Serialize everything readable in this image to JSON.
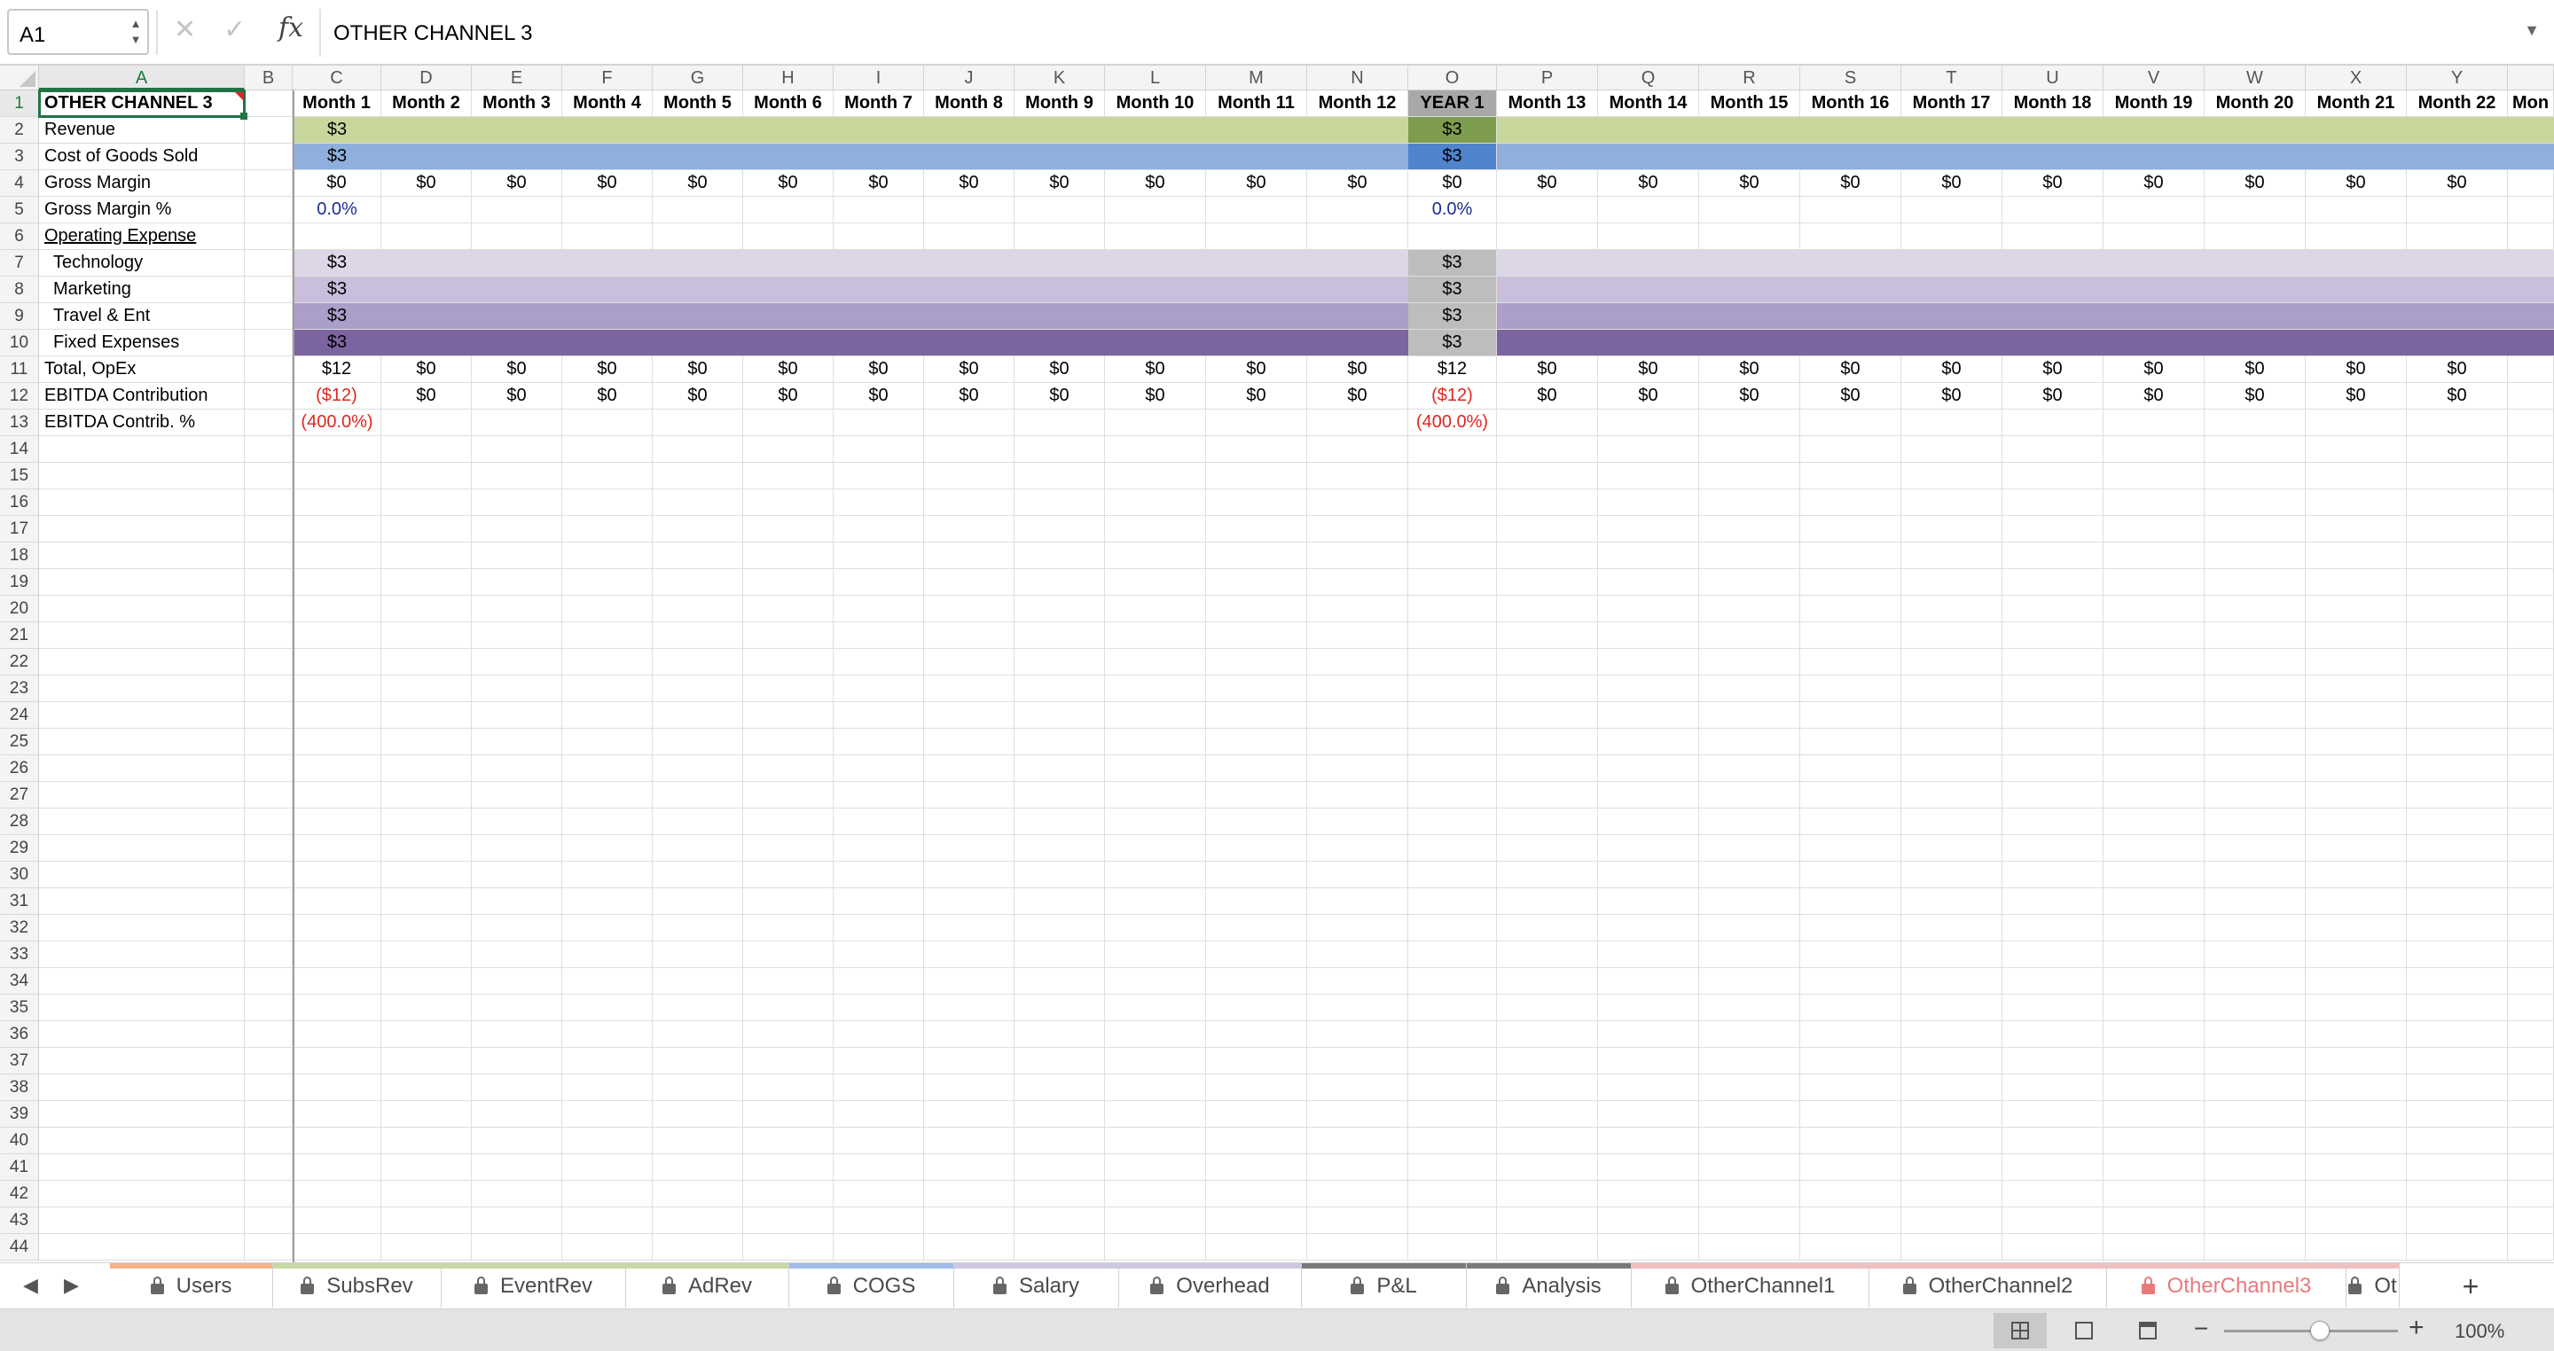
{
  "formula_bar": {
    "name_box": "A1",
    "formula": "OTHER CHANNEL 3",
    "fx_label": "fx"
  },
  "columns": [
    "A",
    "B",
    "C",
    "D",
    "E",
    "F",
    "G",
    "H",
    "I",
    "J",
    "K",
    "L",
    "M",
    "N",
    "O",
    "P",
    "Q",
    "R",
    "S",
    "T",
    "U",
    "V",
    "W",
    "X",
    "Y"
  ],
  "header_row": [
    "OTHER CHANNEL 3",
    "",
    "Month 1",
    "Month 2",
    "Month 3",
    "Month 4",
    "Month 5",
    "Month 6",
    "Month 7",
    "Month 8",
    "Month 9",
    "Month 10",
    "Month 11",
    "Month 12",
    "YEAR 1",
    "Month 13",
    "Month 14",
    "Month 15",
    "Month 16",
    "Month 17",
    "Month 18",
    "Month 19",
    "Month 20",
    "Month 21",
    "Month 22",
    "Mon"
  ],
  "rows": [
    {
      "label": "Revenue",
      "c": "$3",
      "o": "$3",
      "fill": "revenue"
    },
    {
      "label": "Cost of Goods Sold",
      "c": "$3",
      "o": "$3",
      "fill": "cogs"
    },
    {
      "label": "Gross Margin",
      "values": [
        "$0",
        "$0",
        "$0",
        "$0",
        "$0",
        "$0",
        "$0",
        "$0",
        "$0",
        "$0",
        "$0",
        "$0",
        "$0",
        "$0",
        "$0",
        "$0",
        "$0",
        "$0",
        "$0",
        "$0",
        "$0",
        "$0",
        "$0"
      ]
    },
    {
      "label": "Gross Margin %",
      "c": "0.0%",
      "o": "0.0%",
      "style": "pct"
    },
    {
      "label": "Operating Expense",
      "style": "underline"
    },
    {
      "label": "Technology",
      "c": "$3",
      "o": "$3",
      "fill": "tech",
      "indent": true
    },
    {
      "label": "Marketing",
      "c": "$3",
      "o": "$3",
      "fill": "mkt",
      "indent": true
    },
    {
      "label": "Travel & Ent",
      "c": "$3",
      "o": "$3",
      "fill": "travel",
      "indent": true
    },
    {
      "label": "Fixed Expenses",
      "c": "$3",
      "o": "$3",
      "fill": "fixed",
      "indent": true
    },
    {
      "label": "Total, OpEx",
      "values": [
        "$12",
        "$0",
        "$0",
        "$0",
        "$0",
        "$0",
        "$0",
        "$0",
        "$0",
        "$0",
        "$0",
        "$0",
        "$12",
        "$0",
        "$0",
        "$0",
        "$0",
        "$0",
        "$0",
        "$0",
        "$0",
        "$0",
        "$0"
      ]
    },
    {
      "label": "EBITDA Contribution",
      "values": [
        "($12)",
        "$0",
        "$0",
        "$0",
        "$0",
        "$0",
        "$0",
        "$0",
        "$0",
        "$0",
        "$0",
        "$0",
        "($12)",
        "$0",
        "$0",
        "$0",
        "$0",
        "$0",
        "$0",
        "$0",
        "$0",
        "$0",
        "$0"
      ],
      "neg_cols": [
        0,
        12
      ]
    },
    {
      "label": "EBITDA Contrib. %",
      "c": "(400.0%)",
      "o": "(400.0%)",
      "style": "neg"
    }
  ],
  "colors": {
    "revenue": "#c9d79d",
    "revenue_year": "#7e9c4d",
    "cogs": "#8fb0dd",
    "cogs_year": "#4f84cc",
    "tech": "#dcd6e7",
    "mkt": "#c9bfdc",
    "travel": "#ab9ec8",
    "fixed": "#7b64a0",
    "opex_year": "#bdbdbd",
    "year_header": "#a8a8a8",
    "accent": "#217346"
  },
  "tabs": [
    {
      "label": "Users",
      "color": "#f3b38a",
      "locked": true
    },
    {
      "label": "SubsRev",
      "color": "#c6d9a6",
      "locked": true
    },
    {
      "label": "EventRev",
      "color": "#c6d9a6",
      "locked": true
    },
    {
      "label": "AdRev",
      "color": "#c6d9a6",
      "locked": true
    },
    {
      "label": "COGS",
      "color": "#9fbde6",
      "locked": true
    },
    {
      "label": "Salary",
      "color": "#cfc7e2",
      "locked": true
    },
    {
      "label": "Overhead",
      "color": "#cfc7e2",
      "locked": true
    },
    {
      "label": "P&L",
      "color": "#7a7a7a",
      "locked": true
    },
    {
      "label": "Analysis",
      "color": "#7a7a7a",
      "locked": true
    },
    {
      "label": "OtherChannel1",
      "color": "#f0c0c0",
      "locked": true
    },
    {
      "label": "OtherChannel2",
      "color": "#f0c0c0",
      "locked": true
    },
    {
      "label": "OtherChannel3",
      "color": "#f0c0c0",
      "locked": true,
      "active": true
    },
    {
      "label": "Ot",
      "color": "#f0c0c0",
      "locked": true
    }
  ],
  "status": {
    "zoom": "100%",
    "zoom_fraction": 0.55
  }
}
